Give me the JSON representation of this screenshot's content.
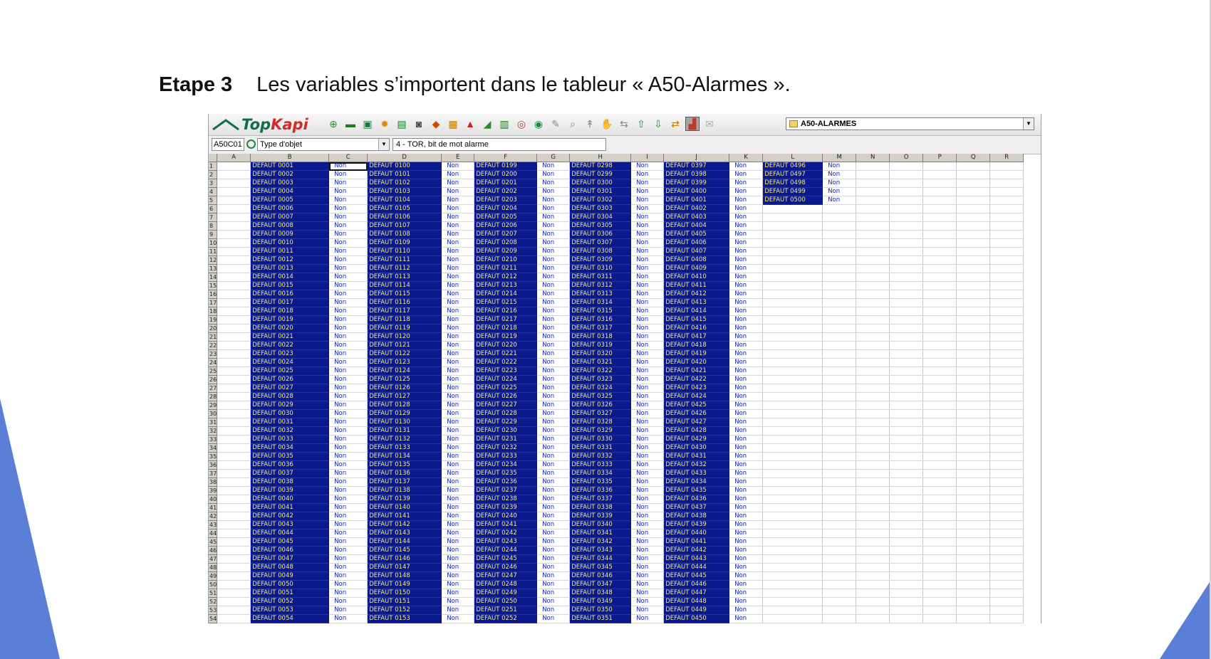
{
  "slide": {
    "step": "Etape 3",
    "text": "Les variables s’importent dans le tableur « A50-Alarmes »."
  },
  "app": {
    "logo": {
      "part1": "Top",
      "part2": "Kapi"
    },
    "toolbar_icons": [
      "add-icon",
      "folder-icon",
      "save-icon",
      "gear-icon",
      "printer-icon",
      "camera-icon",
      "shapes-icon",
      "table-icon",
      "warning-icon",
      "truck-icon",
      "spreadsheet-icon",
      "globe-icon",
      "gauge-icon",
      "wrench-icon",
      "zoom-icon",
      "pointer-icon",
      "hand-icon",
      "connect-icon",
      "upload-icon",
      "download-icon",
      "transfer-icon",
      "chart-icon",
      "mail-icon"
    ],
    "sheet_select": {
      "value": "A50-ALARMES"
    },
    "formula_bar": {
      "cell_ref": "A50C01",
      "type_label": "Type d'objet",
      "value": "4 - TOR, bit de mot alarme"
    },
    "columns": [
      "A",
      "B",
      "C",
      "D",
      "E",
      "F",
      "G",
      "H",
      "I",
      "J",
      "K",
      "L",
      "M",
      "N",
      "O",
      "P",
      "Q",
      "R"
    ],
    "label_prefix": "DEFAUT ",
    "non_label": "Non",
    "visible_rows": 56,
    "col_groups": [
      {
        "label_col": "B",
        "value_col": "C",
        "start": 1,
        "count": 56
      },
      {
        "label_col": "D",
        "value_col": "E",
        "start": 100,
        "count": 56
      },
      {
        "label_col": "F",
        "value_col": "G",
        "start": 199,
        "count": 56
      },
      {
        "label_col": "H",
        "value_col": "I",
        "start": 298,
        "count": 56
      },
      {
        "label_col": "J",
        "value_col": "K",
        "start": 397,
        "count": 56
      },
      {
        "label_col": "L",
        "value_col": "M",
        "start": 496,
        "count": 5
      }
    ],
    "active_cell": "C1"
  }
}
